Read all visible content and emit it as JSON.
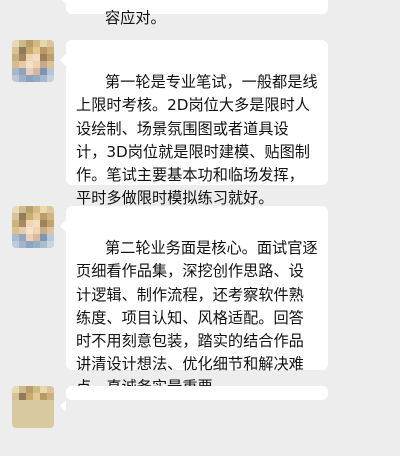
{
  "messages": [
    {
      "text": "容应对。"
    },
    {
      "sender_avatar": "pixelated-avatar",
      "text": "第一轮是专业笔试，一般都是线上限时考核。2D岗位大多是限时人设绘制、场景氛围图或者道具设计，3D岗位就是限时建模、贴图制作。笔试主要基本功和临场发挥，平时多做限时模拟练习就好。"
    },
    {
      "sender_avatar": "pixelated-avatar",
      "text": "第二轮业务面是核心。面试官逐页细看作品集，深挖创作思路、设计逻辑、制作流程，还考察软件熟练度、项目认知、风格适配。回答时不用刻意包装，踏实的结合作品讲清设计想法、优化细节和解决难点，真诚务实最重要。"
    },
    {
      "sender_avatar": "pixelated-avatar",
      "text": ""
    }
  ],
  "colors": {
    "background": "#ededed",
    "bubble": "#ffffff",
    "text": "#111111"
  }
}
